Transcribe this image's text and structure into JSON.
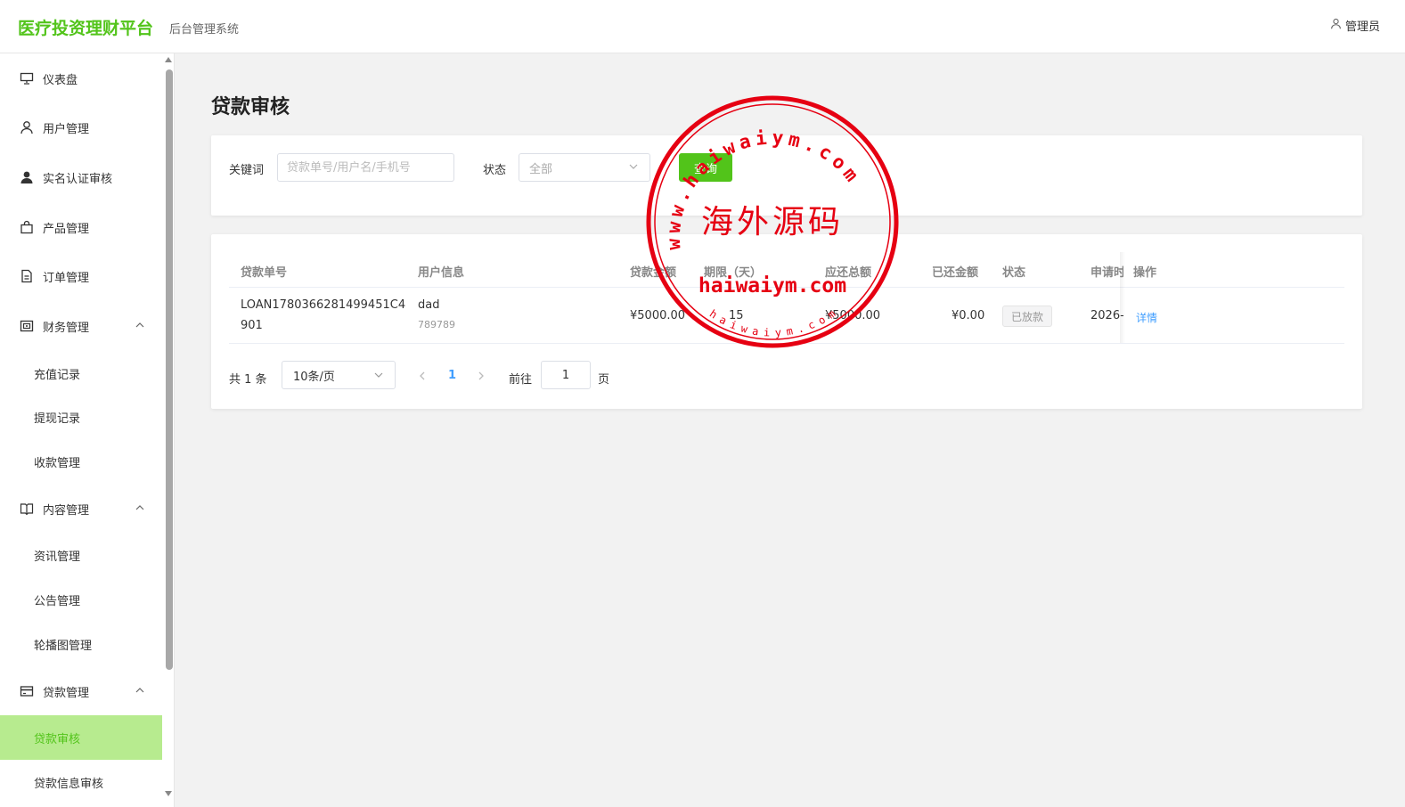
{
  "header": {
    "brand": "医疗投资理财平台",
    "subtitle": "后台管理系统",
    "user_label": "管理员"
  },
  "sidebar": {
    "items": [
      {
        "label": "仪表盘",
        "icon": "presentation-icon"
      },
      {
        "label": "用户管理",
        "icon": "user-icon"
      },
      {
        "label": "实名认证审核",
        "icon": "user-filled-icon"
      },
      {
        "label": "产品管理",
        "icon": "shopping-bag-icon"
      },
      {
        "label": "订单管理",
        "icon": "document-icon"
      },
      {
        "label": "财务管理",
        "icon": "wallet-icon",
        "expanded": true
      },
      {
        "label": "内容管理",
        "icon": "book-icon",
        "expanded": true
      },
      {
        "label": "贷款管理",
        "icon": "credit-card-icon",
        "expanded": true
      }
    ],
    "finance_sub": [
      "充值记录",
      "提现记录",
      "收款管理"
    ],
    "content_sub": [
      "资讯管理",
      "公告管理",
      "轮播图管理"
    ],
    "loan_sub": [
      "贷款审核",
      "贷款信息审核"
    ],
    "active": "贷款审核"
  },
  "page": {
    "title": "贷款审核"
  },
  "search": {
    "keyword_label": "关键词",
    "keyword_placeholder": "贷款单号/用户名/手机号",
    "keyword_value": "",
    "status_label": "状态",
    "status_value": "全部",
    "query_button": "查询"
  },
  "table": {
    "columns": [
      "贷款单号",
      "用户信息",
      "贷款金额",
      "期限（天）",
      "应还总额",
      "已还金额",
      "状态",
      "申请时",
      "操作"
    ],
    "rows": [
      {
        "loan_no_line1": "LOAN1780366281499451C4",
        "loan_no_line2": "901",
        "user_name": "dad",
        "user_phone": "789789",
        "amount": "¥5000.00",
        "term": "15",
        "total_due": "¥5000.00",
        "repaid": "¥0.00",
        "status": "已放款",
        "apply_time": "2026-",
        "action": "详情"
      }
    ]
  },
  "pagination": {
    "total_text": "共 1 条",
    "page_size": "10条/页",
    "current_page": "1",
    "goto_label": "前往",
    "goto_value": "1",
    "page_suffix": "页"
  },
  "watermark": {
    "top_arc": "www.haiwaiym.com",
    "center": "海外源码",
    "bottom_url": "haiwaiym.com",
    "bottom_arc": "haiwaiym.com",
    "color": "#e60012"
  },
  "colors": {
    "brand": "#52c41a",
    "active_bg": "#b7eb8f",
    "link": "#409eff"
  }
}
